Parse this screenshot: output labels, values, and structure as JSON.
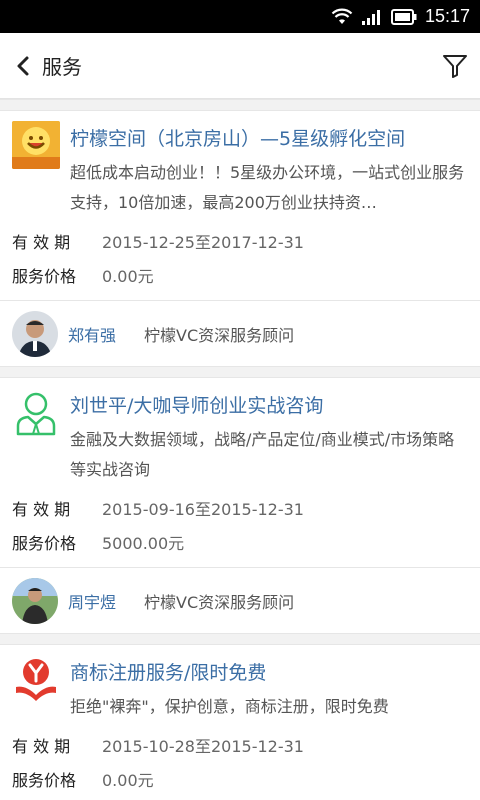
{
  "status_bar": {
    "time": "15:17"
  },
  "header": {
    "title": "服务"
  },
  "labels": {
    "validity": "有 效 期",
    "price": "服务价格"
  },
  "cards": [
    {
      "title": "柠檬空间（北京房山）—5星级孵化空间",
      "desc": "超低成本启动创业！！5星级办公环境，一站式创业服务支持，10倍加速，最高200万创业扶持资…",
      "validity": "2015-12-25至2017-12-31",
      "price": "0.00元",
      "consultant_name": "郑有强",
      "consultant_role": "柠檬VC资深服务顾问"
    },
    {
      "title": "刘世平/大咖导师创业实战咨询",
      "desc": "金融及大数据领域，战略/产品定位/商业模式/市场策略等实战咨询",
      "validity": "2015-09-16至2015-12-31",
      "price": "5000.00元",
      "consultant_name": "周宇煜",
      "consultant_role": "柠檬VC资深服务顾问"
    },
    {
      "title": "商标注册服务/限时免费",
      "desc": "拒绝\"裸奔\"，保护创意，商标注册，限时免费",
      "validity": "2015-10-28至2015-12-31",
      "price": "0.00元"
    }
  ]
}
